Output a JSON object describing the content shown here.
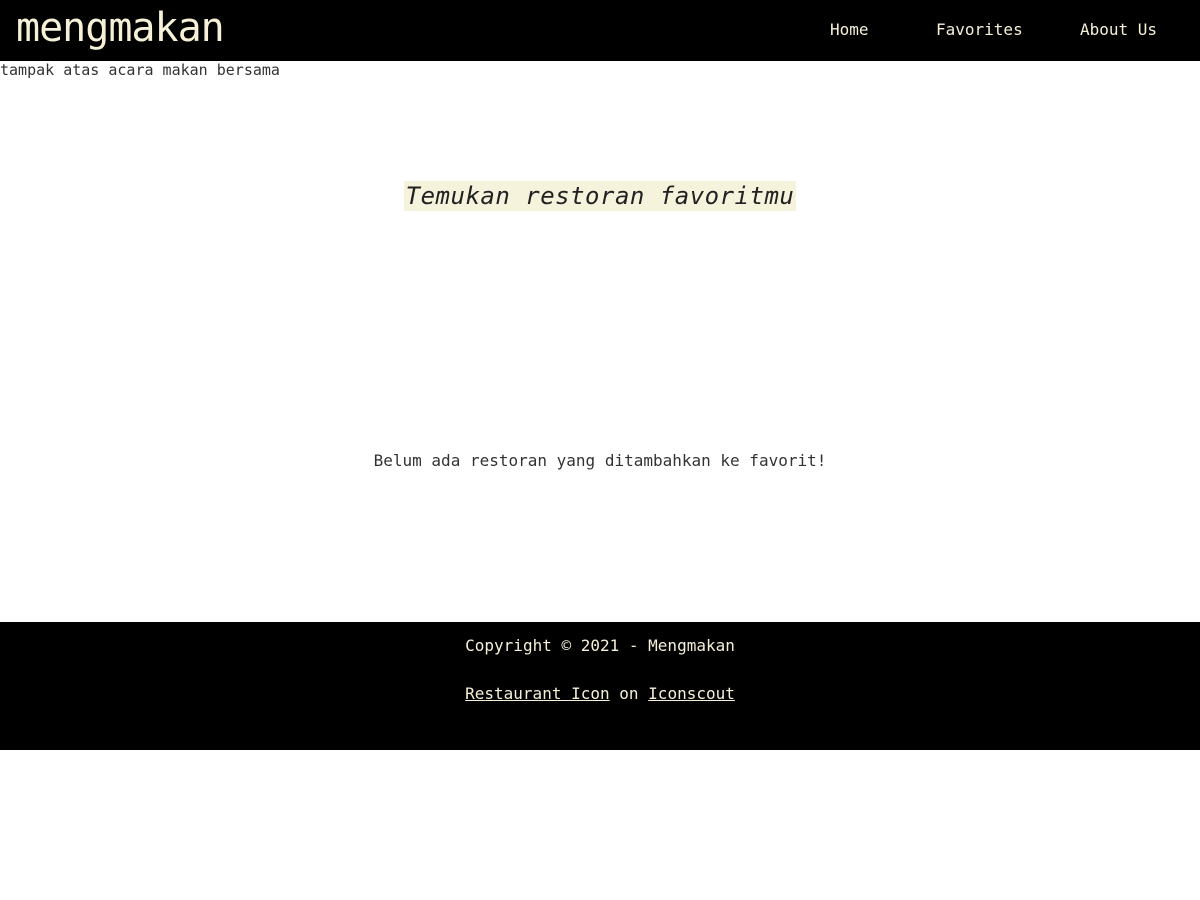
{
  "header": {
    "brand": "mengmakan",
    "nav": {
      "home": "Home",
      "favorites": "Favorites",
      "about": "About Us"
    }
  },
  "hero": {
    "image_alt": "tampak atas acara makan bersama"
  },
  "main": {
    "heading": "Temukan restoran favoritmu",
    "empty_message": "Belum ada restoran yang ditambahkan ke favorit!"
  },
  "footer": {
    "copyright": "Copyright © 2021 - Mengmakan",
    "credit_link_1": "Restaurant Icon",
    "credit_separator": "on",
    "credit_link_2": "Iconscout"
  },
  "colors": {
    "navbar_bg": "#000000",
    "accent_text": "#f5f0d6",
    "heading_highlight": "#f5f3dc"
  }
}
